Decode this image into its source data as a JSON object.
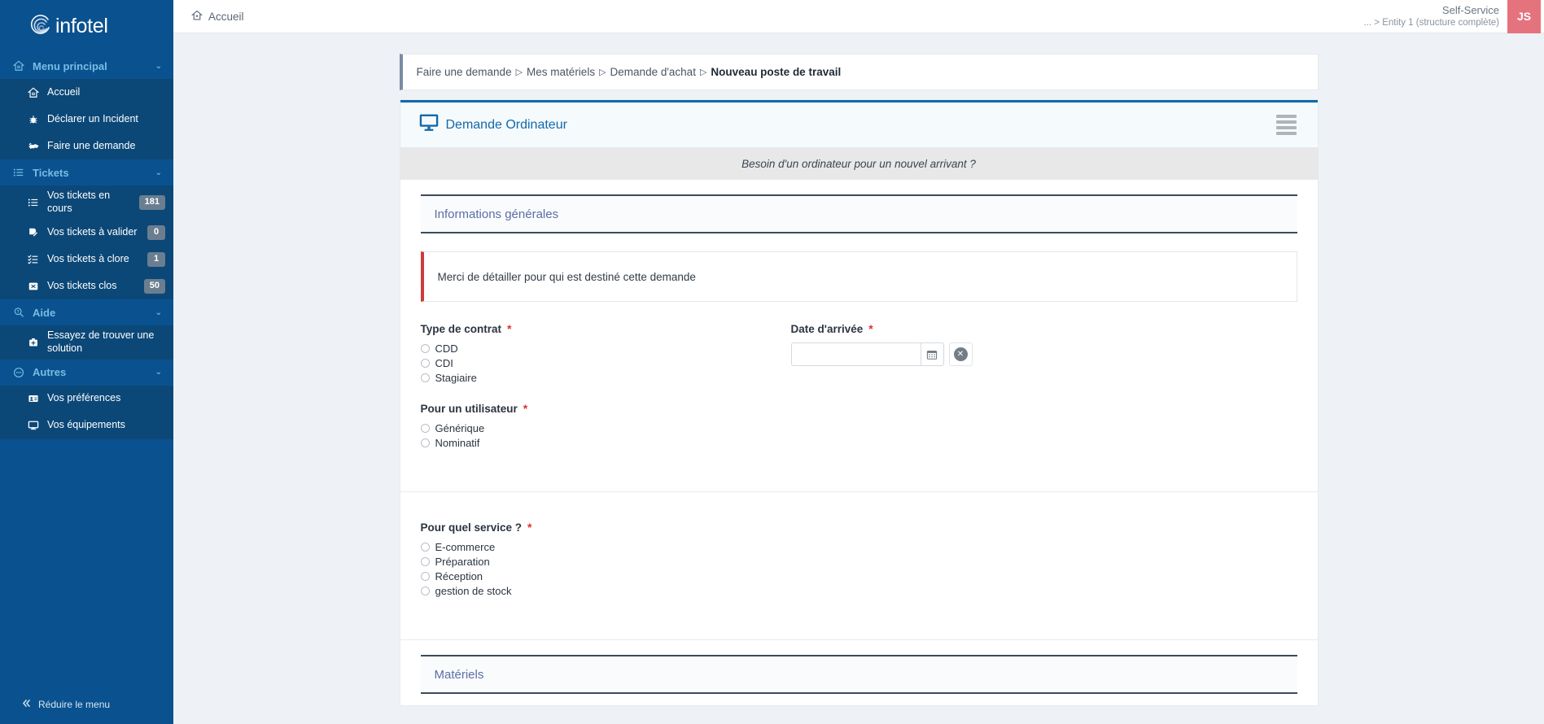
{
  "brand": {
    "name": "infotel",
    "logo_icon": "spiral-logo-icon"
  },
  "sidebar": {
    "groups": [
      {
        "label": "Menu principal",
        "icon": "home-icon",
        "chevron": "chevron-down-icon",
        "items": [
          {
            "label": "Accueil",
            "icon": "home-icon",
            "badge": null
          },
          {
            "label": "Déclarer un Incident",
            "icon": "bug-icon",
            "badge": null
          },
          {
            "label": "Faire une demande",
            "icon": "handshake-icon",
            "badge": null
          }
        ]
      },
      {
        "label": "Tickets",
        "icon": "list-icon",
        "chevron": "chevron-down-icon",
        "items": [
          {
            "label": "Vos tickets en cours",
            "icon": "list-icon",
            "badge": "181"
          },
          {
            "label": "Vos tickets à valider",
            "icon": "document-edit-icon",
            "badge": "0"
          },
          {
            "label": "Vos tickets à clore",
            "icon": "checklist-icon",
            "badge": "1"
          },
          {
            "label": "Vos tickets clos",
            "icon": "close-box-icon",
            "badge": "50"
          }
        ]
      },
      {
        "label": "Aide",
        "icon": "search-help-icon",
        "chevron": "chevron-down-icon",
        "items": [
          {
            "label": "Essayez de trouver une solution",
            "icon": "first-aid-kit-icon",
            "badge": null
          }
        ]
      },
      {
        "label": "Autres",
        "icon": "dots-circle-icon",
        "chevron": "chevron-down-icon",
        "items": [
          {
            "label": "Vos préférences",
            "icon": "id-card-icon",
            "badge": null
          },
          {
            "label": "Vos équipements",
            "icon": "monitor-icon",
            "badge": null
          }
        ]
      }
    ],
    "collapse": {
      "label": "Réduire le menu",
      "icon": "double-chevron-left-icon"
    }
  },
  "topbar": {
    "home_label": "Accueil",
    "home_icon": "home-icon",
    "profile_title": "Self-Service",
    "profile_entity": "... > Entity 1 (structure complète)",
    "avatar_initials": "JS",
    "avatar_color": "#e4737e"
  },
  "breadcrumb": {
    "items": [
      "Faire une demande",
      "Mes matériels",
      "Demande d'achat"
    ],
    "separator": "▷",
    "current": "Nouveau poste de travail"
  },
  "form": {
    "title": "Demande Ordinateur",
    "title_icon": "monitor-icon",
    "menu_icon": "hamburger-menu-icon",
    "subtitle": "Besoin d'un ordinateur pour un nouvel arrivant ?",
    "sections": [
      {
        "title": "Informations générales"
      },
      {
        "title": "Matériels"
      }
    ],
    "notice": "Merci de détailler pour qui est destiné cette demande",
    "fields": {
      "type_contrat": {
        "label": "Type de contrat",
        "required_marker": "*",
        "options": [
          "CDD",
          "CDI",
          "Stagiaire"
        ],
        "selected": null
      },
      "date_arrivee": {
        "label": "Date d'arrivée",
        "required_marker": "*",
        "value": "",
        "placeholder": "",
        "calendar_icon": "calendar-icon",
        "clear_icon": "clear-circle-icon"
      },
      "pour_utilisateur": {
        "label": "Pour un utilisateur",
        "required_marker": "*",
        "options": [
          "Générique",
          "Nominatif"
        ],
        "selected": null
      },
      "pour_quel_service": {
        "label": "Pour quel service ?",
        "required_marker": "*",
        "options": [
          "E-commerce",
          "Préparation",
          "Réception",
          "gestion de stock"
        ],
        "selected": null
      }
    }
  },
  "colors": {
    "sidebar_bg": "#0a528f",
    "sidebar_sub_bg": "#0b4878",
    "accent_blue": "#1468a8",
    "required_red": "#e03131",
    "notice_bar": "#cf3b3b",
    "badge_bg": "#6b7e8f"
  }
}
